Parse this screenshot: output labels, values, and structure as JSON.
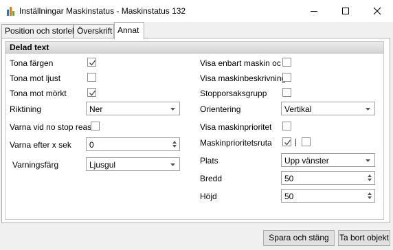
{
  "window": {
    "title": "Inställningar Maskinstatus - Maskinstatus 132",
    "icon": "bar-chart-app-icon"
  },
  "tabs": [
    {
      "label": "Position och storlek",
      "active": false
    },
    {
      "label": "Överskrift",
      "active": false
    },
    {
      "label": "Annat",
      "active": true
    }
  ],
  "group": {
    "title": "Delad text"
  },
  "left": {
    "tona_fargen": {
      "label": "Tona färgen",
      "checked": true
    },
    "tona_mot_ljust": {
      "label": "Tona mot ljust",
      "checked": false
    },
    "tona_mot_morkt": {
      "label": "Tona mot mörkt",
      "checked": true
    },
    "riktning": {
      "label": "Riktining",
      "value": "Ner"
    },
    "varna_no_stop": {
      "label": "Varna vid no stop reaso",
      "checked": false
    },
    "varna_efter": {
      "label": "Varna efter x sek",
      "value": "0"
    },
    "varningsfarg": {
      "label": "Varningsfärg",
      "value": "Ljusgul"
    }
  },
  "right": {
    "visa_enbart": {
      "label": "Visa enbart maskin och stoppfärg",
      "checked": false
    },
    "visa_beskrivning": {
      "label": "Visa maskinbeskrivning",
      "checked": false
    },
    "stopporsaksgrupp": {
      "label": "Stopporsaksgrupp",
      "checked": false
    },
    "orientering": {
      "label": "Orientering",
      "value": "Vertikal"
    },
    "visa_prioritet": {
      "label": "Visa maskinprioritet",
      "checked": false
    },
    "prioritetsruta": {
      "label": "Maskinprioritetsruta",
      "checked_a": true,
      "checked_b": false
    },
    "plats": {
      "label": "Plats",
      "value": "Upp vänster"
    },
    "bredd": {
      "label": "Bredd",
      "value": "50"
    },
    "hojd": {
      "label": "Höjd",
      "value": "50"
    }
  },
  "buttons": {
    "save_close": "Spara och stäng",
    "delete": "Ta bort objekt"
  }
}
